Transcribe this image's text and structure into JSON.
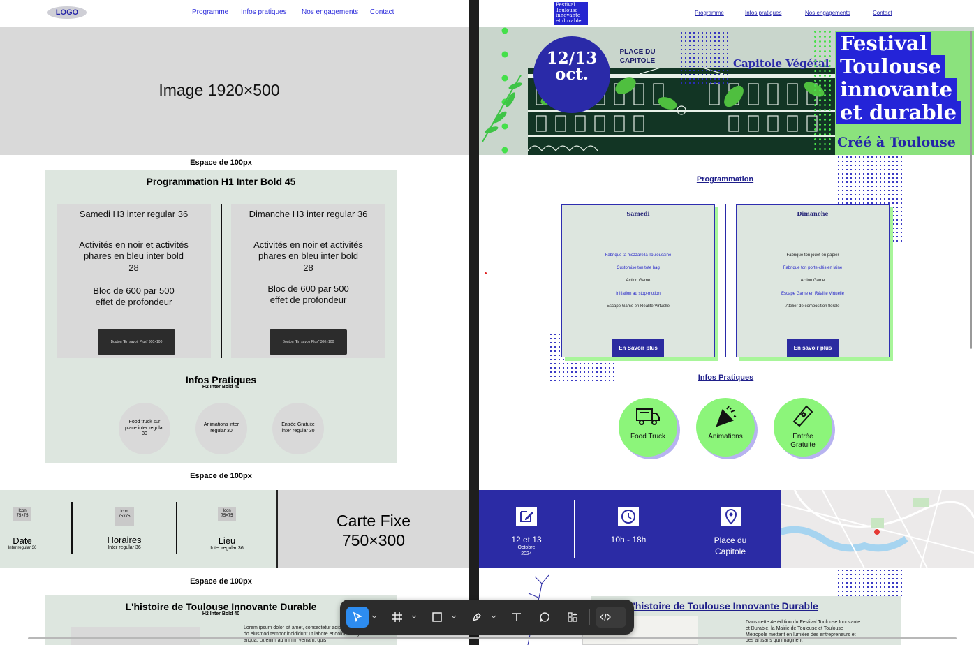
{
  "wireframe": {
    "logo": "LOGO",
    "nav": [
      "Programme",
      "Infos pratiques",
      "Nos engagements",
      "Contact"
    ],
    "hero_label": "Image 1920×500",
    "spacer_label": "Espace de 100px",
    "programmation_title": "Programmation H1 Inter Bold 45",
    "day_cards": [
      {
        "title": "Samedi H3 inter regular 36",
        "desc": "Activités en noir et activités phares en bleu inter bold 28",
        "size": "Bloc de 600 par 500 effet de profondeur",
        "button": "Bouton \"En savoir Plus\" 300×100"
      },
      {
        "title": "Dimanche H3 inter regular 36",
        "desc": "Activités en noir et activités phares en bleu inter bold 28",
        "size": "Bloc de 600 par 500 effet de profondeur",
        "button": "Bouton \"En savoir Plus\" 300×100"
      }
    ],
    "infos_title": "Infos Pratiques",
    "infos_sub": "H2 Inter Bold 40",
    "info_circles": [
      "Food truck sur place inter regular 30",
      "Animations inter regular 30",
      "Entrée Gratuite inter regular 30"
    ],
    "spacer2_label": "Espace de 100px",
    "band_items": [
      {
        "icon": "Icon 75×75",
        "title": "Date",
        "sub": "Inter regular 36"
      },
      {
        "icon": "Icon 75×75",
        "title": "Horaires",
        "sub": "Inter regular 36"
      },
      {
        "icon": "Icon 75×75",
        "title": "Lieu",
        "sub": "Inter regular 36"
      }
    ],
    "map_label_1": "Carte Fixe",
    "map_label_2": "750×300",
    "spacer3_label": "Espace de 100px",
    "history_title": "L'histoire de Toulouse Innovante Durable",
    "history_sub": "H2 Inter Bold 40",
    "lorem": "Lorem ipsum dolor sit amet, consectetur adipiscing elit, sed do eiusmod tempor incididunt ut labore et dolore magna aliqua. Ut enim ad minim veniam, quis"
  },
  "mockup": {
    "logo_lines": [
      "Festival",
      "Toulouse",
      "innovante",
      "et durable"
    ],
    "nav": [
      "Programme",
      "Infos pratiques",
      "Nos engagements",
      "Contact"
    ],
    "hero": {
      "date_line1": "12/13",
      "date_line2": "oct.",
      "place": "PLACE DU CAPITOLE",
      "subtitle": "Capitole Végétal",
      "title_lines": [
        "Festival",
        "Toulouse",
        "innovante",
        "et durable"
      ],
      "tagline": "Créé à Toulouse"
    },
    "programmation_title": "Programmation",
    "cards": [
      {
        "title": "Samedi",
        "button": "En Savoir plus",
        "activities": [
          {
            "text": "Fabrique ta mozzarella Toulousaine",
            "featured": true
          },
          {
            "text": "Customise ton tote bag",
            "featured": true
          },
          {
            "text": "Action Game",
            "featured": false
          },
          {
            "text": "Initiation au stop-motion",
            "featured": true
          },
          {
            "text": "Escape Game en Réalité Virtuelle",
            "featured": false
          }
        ]
      },
      {
        "title": "Dimanche",
        "button": "En savoir plus",
        "activities": [
          {
            "text": "Fabrique ton jouet en papier",
            "featured": false
          },
          {
            "text": "Fabrique ton porte-clés en laine",
            "featured": true
          },
          {
            "text": "Action Game",
            "featured": false
          },
          {
            "text": "Escape Game en Réalité Virtuelle",
            "featured": true
          },
          {
            "text": "Atelier de composition florale",
            "featured": false
          }
        ]
      }
    ],
    "infos_title": "Infos Pratiques",
    "info_circles": [
      {
        "icon": "food-truck-icon",
        "label": "Food Truck"
      },
      {
        "icon": "party-popper-icon",
        "label": "Animations"
      },
      {
        "icon": "ticket-icon",
        "label": "Entrée Gratuite"
      }
    ],
    "band": [
      {
        "icon": "edit-calendar-icon",
        "title": "12 et 13",
        "sub1": "Octobre",
        "sub2": "2024"
      },
      {
        "icon": "clock-icon",
        "title": "10h - 18h",
        "sub1": "",
        "sub2": ""
      },
      {
        "icon": "location-pin-icon",
        "title": "Place du Capitole",
        "sub1": "",
        "sub2": ""
      }
    ],
    "history_title": "L'histoire de Toulouse Innovante Durable",
    "history_text": "Dans cette 4e édition du Festival Toulouse Innovante et Durable, la Mairie de Toulouse et Toulouse Métropole mettent en lumière des entrepreneurs et des artisans qui imaginent"
  },
  "toolbar": {
    "tools": [
      "move-tool",
      "frame-tool",
      "shape-tool",
      "pen-tool",
      "text-tool",
      "comment-tool",
      "actions-tool",
      "dev-mode-toggle"
    ]
  },
  "colors": {
    "accent_blue": "#2b2ba5",
    "accent_green": "#8cf57a",
    "wire_mint": "#dde6df",
    "wire_grey": "#d9d9d9"
  }
}
